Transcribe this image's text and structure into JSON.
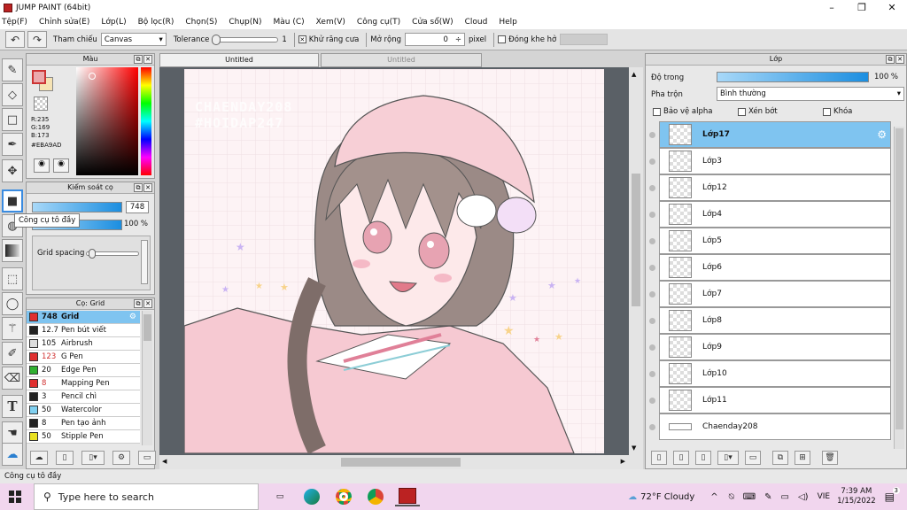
{
  "window": {
    "title": "JUMP PAINT (64bit)",
    "buttons": [
      "–",
      "❐",
      "✕"
    ]
  },
  "menu": [
    "Tệp(F)",
    "Chỉnh sửa(E)",
    "Lớp(L)",
    "Bộ lọc(R)",
    "Chọn(S)",
    "Chụp(N)",
    "Màu (C)",
    "Xem(V)",
    "Công cụ(T)",
    "Cửa sổ(W)",
    "Cloud",
    "Help"
  ],
  "toolbar": {
    "reference_label": "Tham chiếu",
    "reference_value": "Canvas",
    "tolerance_label": "Tolerance",
    "tolerance_value": "1",
    "antialias_label": "Khử răng cưa",
    "expand_label": "Mở rộng",
    "expand_value": "0",
    "expand_unit": "pixel",
    "close_gap_label": "Đóng khe hở"
  },
  "color_panel": {
    "title": "Màu",
    "r": "R:235",
    "g": "G:169",
    "b": "B:173",
    "hex": "#EBA9AD",
    "primary": "#EBA9AD"
  },
  "brush_control": {
    "title": "Kiểm soát cọ",
    "size": "748",
    "opacity": "100 %",
    "grid_spacing_label": "Grid spacing"
  },
  "tooltip": "Công cụ tô đầy",
  "brush_panel": {
    "title": "Cọ: Grid",
    "items": [
      {
        "size": "748",
        "name": "Grid",
        "color": "#e03030"
      },
      {
        "size": "12.7",
        "name": "Pen bút viết",
        "color": "#222222"
      },
      {
        "size": "105",
        "name": "Airbrush",
        "color": "#dddddd"
      },
      {
        "size": "123",
        "name": "G Pen",
        "color": "#e03030"
      },
      {
        "size": "20",
        "name": "Edge Pen",
        "color": "#30b030"
      },
      {
        "size": "8",
        "name": "Mapping Pen",
        "color": "#e03030"
      },
      {
        "size": "3",
        "name": "Pencil chì",
        "color": "#222222"
      },
      {
        "size": "50",
        "name": "Watercolor",
        "color": "#80d0f0"
      },
      {
        "size": "8",
        "name": "Pen tạo ảnh",
        "color": "#222222"
      },
      {
        "size": "50",
        "name": "Stipple Pen",
        "color": "#e8e020"
      }
    ]
  },
  "canvas_tabs": [
    "Untitled",
    "Untitled"
  ],
  "watermark": [
    "CHAENDAY208",
    "#HOIDAP247"
  ],
  "layers_panel": {
    "title": "Lớp",
    "opacity_label": "Độ trong",
    "opacity_value": "100 %",
    "blend_label": "Pha trộn",
    "blend_value": "Bình thường",
    "protect_alpha": "Bảo vệ alpha",
    "clipping": "Xén bớt",
    "lock": "Khóa",
    "layers": [
      "Lớp17",
      "Lớp3",
      "Lớp12",
      "Lớp4",
      "Lớp5",
      "Lớp6",
      "Lớp7",
      "Lớp8",
      "Lớp9",
      "Lớp10",
      "Lớp11",
      "Chaenday208"
    ]
  },
  "status_text": "Công cụ tô đầy",
  "taskbar": {
    "search_placeholder": "Type here to search",
    "weather": "72°F  Cloudy",
    "lang": "VIE",
    "time": "7:39 AM",
    "date": "1/15/2022",
    "notif_count": "3"
  }
}
